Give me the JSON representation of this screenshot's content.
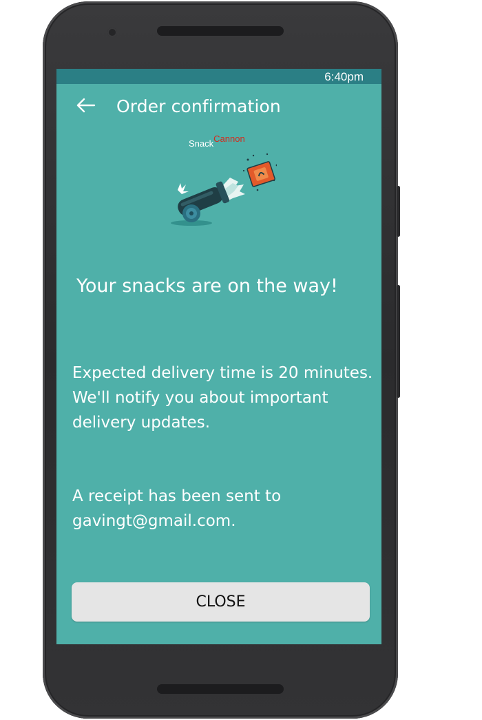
{
  "status_bar": {
    "time": "6:40pm"
  },
  "app_bar": {
    "title": "Order confirmation",
    "back_icon": "arrow-left-icon"
  },
  "logo": {
    "part1": "Snack",
    "part2": "Cannon",
    "part2_color": "#d42a1c"
  },
  "content": {
    "headline": "Your snacks are on the way!",
    "delivery_line1": "Expected delivery time is 20 minutes.",
    "delivery_line2": "We'll notify you about important",
    "delivery_line3": "delivery updates.",
    "receipt_line1": "A receipt has been sent to",
    "receipt_line2": "gavingt@gmail.com."
  },
  "actions": {
    "close_label": "CLOSE"
  },
  "colors": {
    "screen_bg": "#4fb0a9",
    "status_bar_bg": "#2b7f85",
    "button_bg": "#e5e5e5"
  }
}
